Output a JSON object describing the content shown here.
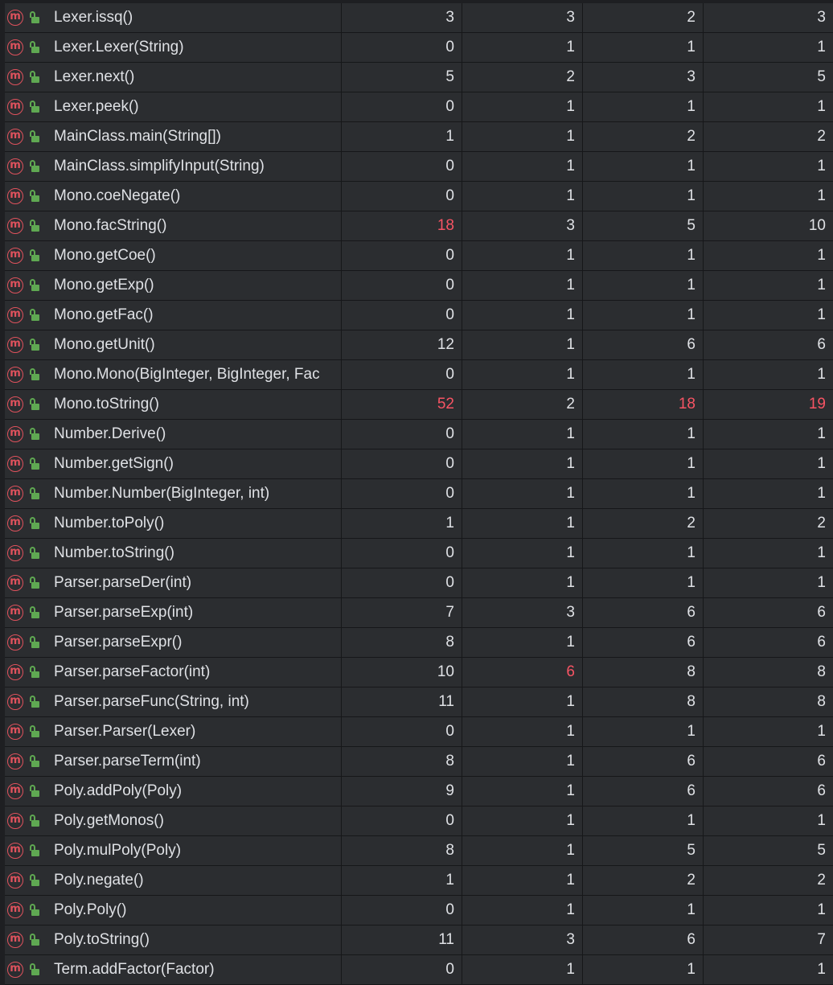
{
  "colors": {
    "background": "#2b2d30",
    "grid": "#161719",
    "text": "#dfe1e5",
    "highlight": "#f75464",
    "method_icon": "#e0525d",
    "access_icon": "#5fa852"
  },
  "icons": {
    "method": "method-m-icon",
    "access": "public-lock-icon",
    "method_glyph": "m"
  },
  "rows": [
    {
      "name": "Lexer.issq()",
      "values": [
        "3",
        "3",
        "2",
        "3"
      ],
      "hot": [
        false,
        false,
        false,
        false
      ]
    },
    {
      "name": "Lexer.Lexer(String)",
      "values": [
        "0",
        "1",
        "1",
        "1"
      ],
      "hot": [
        false,
        false,
        false,
        false
      ]
    },
    {
      "name": "Lexer.next()",
      "values": [
        "5",
        "2",
        "3",
        "5"
      ],
      "hot": [
        false,
        false,
        false,
        false
      ]
    },
    {
      "name": "Lexer.peek()",
      "values": [
        "0",
        "1",
        "1",
        "1"
      ],
      "hot": [
        false,
        false,
        false,
        false
      ]
    },
    {
      "name": "MainClass.main(String[])",
      "values": [
        "1",
        "1",
        "2",
        "2"
      ],
      "hot": [
        false,
        false,
        false,
        false
      ]
    },
    {
      "name": "MainClass.simplifyInput(String)",
      "values": [
        "0",
        "1",
        "1",
        "1"
      ],
      "hot": [
        false,
        false,
        false,
        false
      ]
    },
    {
      "name": "Mono.coeNegate()",
      "values": [
        "0",
        "1",
        "1",
        "1"
      ],
      "hot": [
        false,
        false,
        false,
        false
      ]
    },
    {
      "name": "Mono.facString()",
      "values": [
        "18",
        "3",
        "5",
        "10"
      ],
      "hot": [
        true,
        false,
        false,
        false
      ]
    },
    {
      "name": "Mono.getCoe()",
      "values": [
        "0",
        "1",
        "1",
        "1"
      ],
      "hot": [
        false,
        false,
        false,
        false
      ]
    },
    {
      "name": "Mono.getExp()",
      "values": [
        "0",
        "1",
        "1",
        "1"
      ],
      "hot": [
        false,
        false,
        false,
        false
      ]
    },
    {
      "name": "Mono.getFac()",
      "values": [
        "0",
        "1",
        "1",
        "1"
      ],
      "hot": [
        false,
        false,
        false,
        false
      ]
    },
    {
      "name": "Mono.getUnit()",
      "values": [
        "12",
        "1",
        "6",
        "6"
      ],
      "hot": [
        false,
        false,
        false,
        false
      ]
    },
    {
      "name": "Mono.Mono(BigInteger, BigInteger, Fac",
      "values": [
        "0",
        "1",
        "1",
        "1"
      ],
      "hot": [
        false,
        false,
        false,
        false
      ]
    },
    {
      "name": "Mono.toString()",
      "values": [
        "52",
        "2",
        "18",
        "19"
      ],
      "hot": [
        true,
        false,
        true,
        true
      ]
    },
    {
      "name": "Number.Derive()",
      "values": [
        "0",
        "1",
        "1",
        "1"
      ],
      "hot": [
        false,
        false,
        false,
        false
      ]
    },
    {
      "name": "Number.getSign()",
      "values": [
        "0",
        "1",
        "1",
        "1"
      ],
      "hot": [
        false,
        false,
        false,
        false
      ]
    },
    {
      "name": "Number.Number(BigInteger, int)",
      "values": [
        "0",
        "1",
        "1",
        "1"
      ],
      "hot": [
        false,
        false,
        false,
        false
      ]
    },
    {
      "name": "Number.toPoly()",
      "values": [
        "1",
        "1",
        "2",
        "2"
      ],
      "hot": [
        false,
        false,
        false,
        false
      ]
    },
    {
      "name": "Number.toString()",
      "values": [
        "0",
        "1",
        "1",
        "1"
      ],
      "hot": [
        false,
        false,
        false,
        false
      ]
    },
    {
      "name": "Parser.parseDer(int)",
      "values": [
        "0",
        "1",
        "1",
        "1"
      ],
      "hot": [
        false,
        false,
        false,
        false
      ]
    },
    {
      "name": "Parser.parseExp(int)",
      "values": [
        "7",
        "3",
        "6",
        "6"
      ],
      "hot": [
        false,
        false,
        false,
        false
      ]
    },
    {
      "name": "Parser.parseExpr()",
      "values": [
        "8",
        "1",
        "6",
        "6"
      ],
      "hot": [
        false,
        false,
        false,
        false
      ]
    },
    {
      "name": "Parser.parseFactor(int)",
      "values": [
        "10",
        "6",
        "8",
        "8"
      ],
      "hot": [
        false,
        true,
        false,
        false
      ]
    },
    {
      "name": "Parser.parseFunc(String, int)",
      "values": [
        "11",
        "1",
        "8",
        "8"
      ],
      "hot": [
        false,
        false,
        false,
        false
      ]
    },
    {
      "name": "Parser.Parser(Lexer)",
      "values": [
        "0",
        "1",
        "1",
        "1"
      ],
      "hot": [
        false,
        false,
        false,
        false
      ]
    },
    {
      "name": "Parser.parseTerm(int)",
      "values": [
        "8",
        "1",
        "6",
        "6"
      ],
      "hot": [
        false,
        false,
        false,
        false
      ]
    },
    {
      "name": "Poly.addPoly(Poly)",
      "values": [
        "9",
        "1",
        "6",
        "6"
      ],
      "hot": [
        false,
        false,
        false,
        false
      ]
    },
    {
      "name": "Poly.getMonos()",
      "values": [
        "0",
        "1",
        "1",
        "1"
      ],
      "hot": [
        false,
        false,
        false,
        false
      ]
    },
    {
      "name": "Poly.mulPoly(Poly)",
      "values": [
        "8",
        "1",
        "5",
        "5"
      ],
      "hot": [
        false,
        false,
        false,
        false
      ]
    },
    {
      "name": "Poly.negate()",
      "values": [
        "1",
        "1",
        "2",
        "2"
      ],
      "hot": [
        false,
        false,
        false,
        false
      ]
    },
    {
      "name": "Poly.Poly()",
      "values": [
        "0",
        "1",
        "1",
        "1"
      ],
      "hot": [
        false,
        false,
        false,
        false
      ]
    },
    {
      "name": "Poly.toString()",
      "values": [
        "11",
        "3",
        "6",
        "7"
      ],
      "hot": [
        false,
        false,
        false,
        false
      ]
    },
    {
      "name": "Term.addFactor(Factor)",
      "values": [
        "0",
        "1",
        "1",
        "1"
      ],
      "hot": [
        false,
        false,
        false,
        false
      ]
    }
  ]
}
